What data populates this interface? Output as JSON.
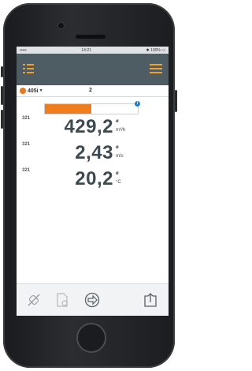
{
  "status_bar": {
    "carrier": "•••••  ",
    "time": "14:21",
    "battery": "✱ 100% ▭"
  },
  "app_bar": {
    "left_icon": "menu-icon",
    "right_icon": "list-icon"
  },
  "device": {
    "name": "405i",
    "probe_color": "#e6781e",
    "page_number": "2"
  },
  "progress": {
    "level": 0.5,
    "fill_color": "#ef7d1e",
    "info_label": "i"
  },
  "readings": [
    {
      "label": "321",
      "value": "429,2",
      "symbol": "ø",
      "unit": "m³/h"
    },
    {
      "label": "321",
      "value": "2,43",
      "symbol": "ø",
      "unit": "m/s"
    },
    {
      "label": "321",
      "value": "20,2",
      "symbol": "ø",
      "unit": "°C"
    }
  ],
  "toolbar": {
    "icons": [
      "no-probe-icon",
      "file-settings-icon",
      "forward-circle-icon",
      "export-icon"
    ]
  },
  "colors": {
    "app_bar": "#4e5d63",
    "value_text": "#3d4a50",
    "accent": "#ef7d1e"
  }
}
